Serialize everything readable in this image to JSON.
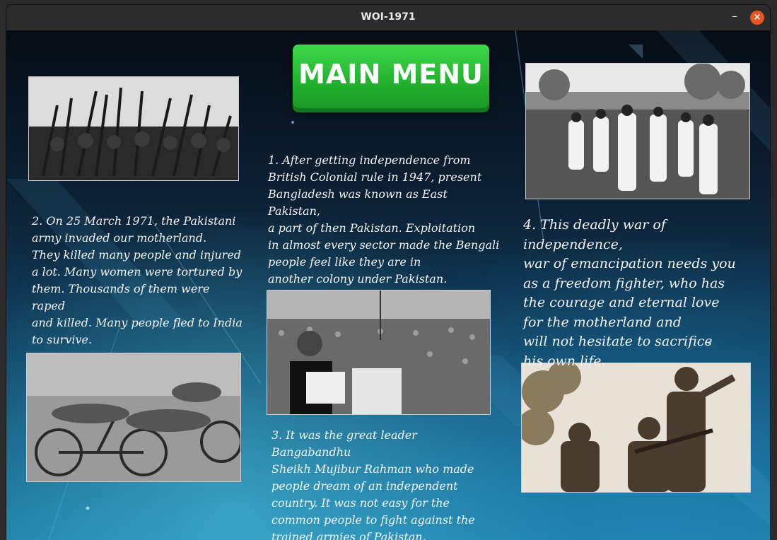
{
  "window": {
    "title": "WOI-1971",
    "minimize_label": "–",
    "close_label": "×"
  },
  "main_menu": {
    "label": "MAIN MENU"
  },
  "paragraphs": {
    "p1": "1. After getting independence from\nBritish Colonial rule in 1947, present\nBangladesh was known as East Pakistan,\na part of then Pakistan. Exploitation\nin almost every  sector made the Bengali\npeople  feel like they are in\n another colony under Pakistan.",
    "p2": "2. On 25 March 1971, the Pakistani\narmy invaded our motherland.\nThey killed many people and injured\na lot. Many women were tortured by\nthem. Thousands of them were raped\nand killed. Many people fled to India\nto survive.",
    "p3": "3. It was the great leader Bangabandhu\nSheikh Mujibur Rahman who made\npeople dream of an independent\ncountry. It was  not easy for the\ncommon people to fight against the\ntrained armies of Pakistan.",
    "p4": "4. This deadly war of independence,\nwar of emancipation needs you\nas a freedom fighter, who has\nthe courage and eternal love\nfor the motherland and\nwill not hesitate to sacrifice\nhis own life."
  },
  "colors": {
    "button_green": "#2bc237",
    "close_orange": "#e95420",
    "bg_dark": "#0b1a2a",
    "bg_cyan": "#1b7aa2"
  }
}
